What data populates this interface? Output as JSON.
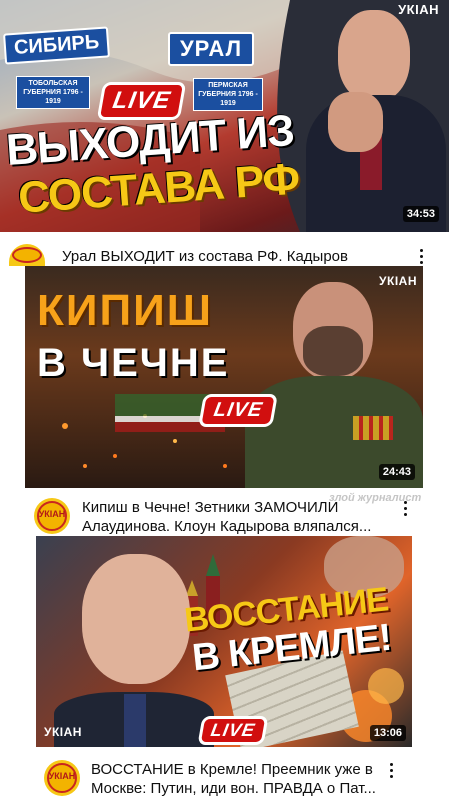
{
  "videos": [
    {
      "thumbnail": {
        "sign_left": "СИБИРЬ",
        "sign_right": "УРАЛ",
        "plate_left": "ТОБОЛЬСКАЯ ГУБЕРНИЯ 1796 - 1919",
        "plate_right": "ПЕРМСКАЯ ГУБЕРНИЯ 1796 - 1919",
        "live": "LIVE",
        "headline_1": "ВЫХОДИТ ИЗ",
        "headline_2": "СОСТАВА РФ",
        "channel_mark": "УКІАН",
        "duration": "34:53"
      },
      "title": "Урал ВЫХОДИТ из состава РФ. Кадыров"
    },
    {
      "thumbnail": {
        "headline_1": "КИПИШ",
        "headline_2": "В ЧЕЧНЕ",
        "live": "LIVE",
        "channel_mark": "УКІАН",
        "duration": "24:43"
      },
      "title_line_1": "Кипиш в Чечне! Зетники ЗАМОЧИЛИ",
      "title_line_2": "Алаудинова. Клоун Кадырова вляпался...",
      "channel_avatar": "УКІАН"
    },
    {
      "thumbnail": {
        "headline_1": "ВОССТАНИЕ",
        "headline_2": "В КРЕМЛЕ!",
        "live": "LIVE",
        "channel_mark": "УКІАН",
        "duration": "13:06"
      },
      "title_line_1": "ВОССТАНИЕ в Кремле! Преемник уже в",
      "title_line_2": "Москве: Путин, иди вон. ПРАВДА о Пат...",
      "channel_avatar": "УКІАН"
    }
  ],
  "watermark": "злой журналист",
  "colors": {
    "accent_red": "#d10f0f",
    "accent_yellow": "#f3b300"
  }
}
